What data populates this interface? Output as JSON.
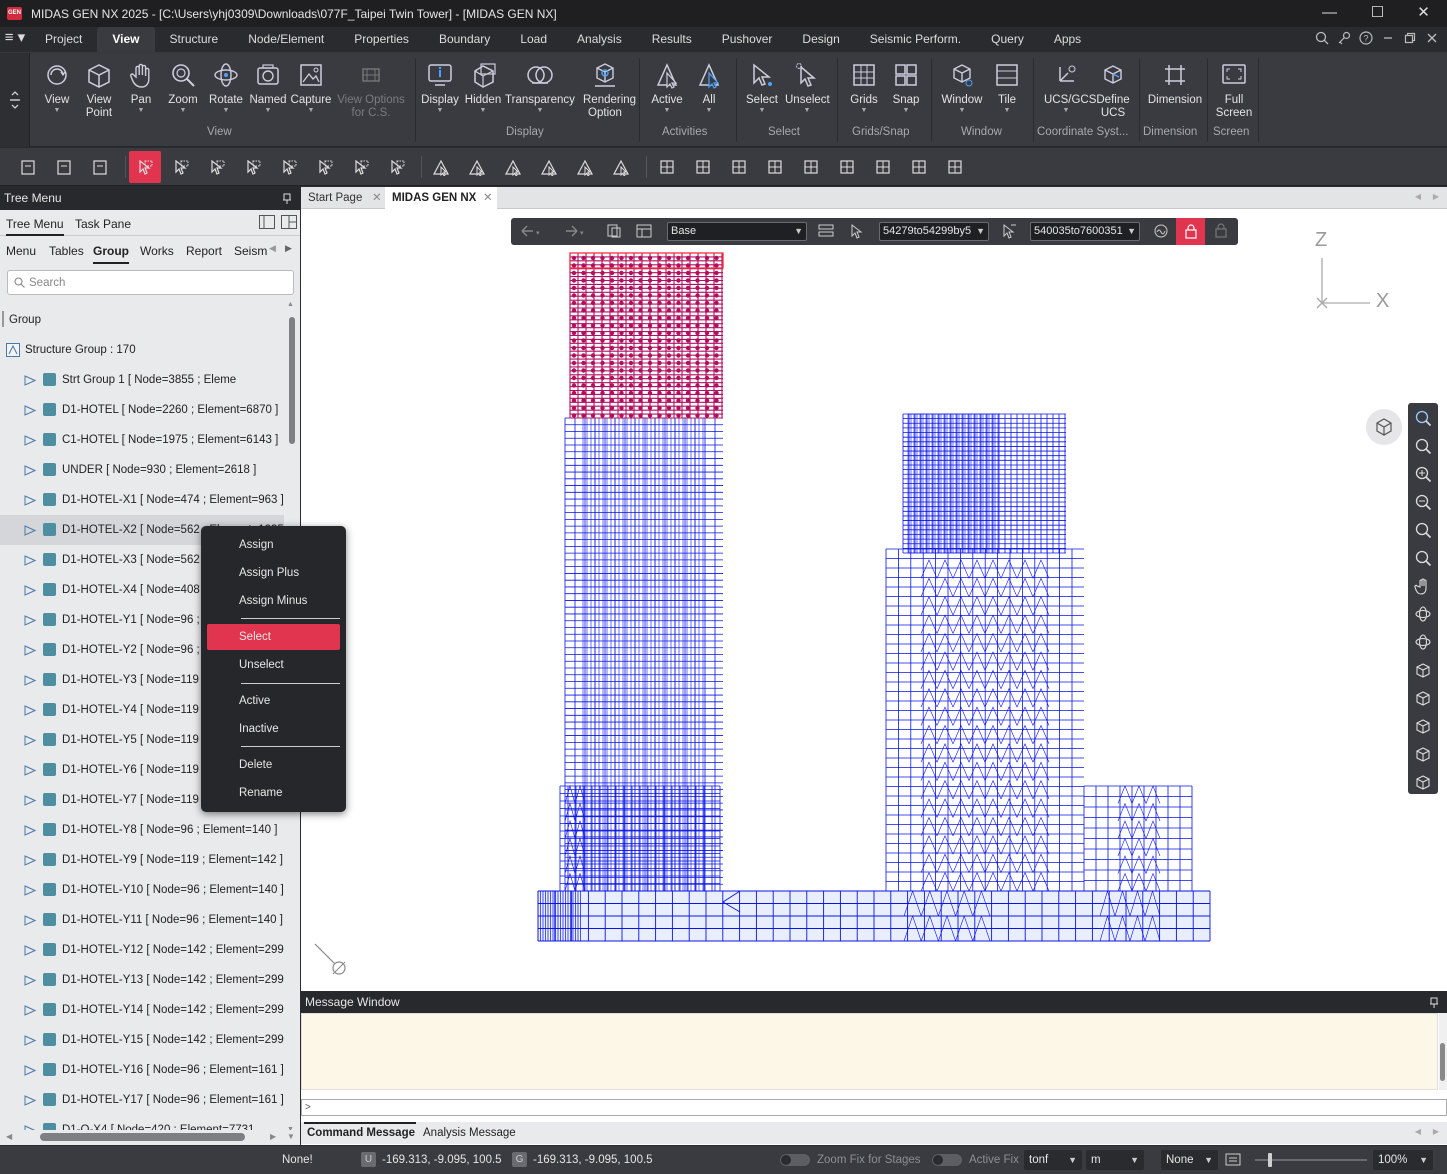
{
  "app": {
    "logo_text": "GEN",
    "title": "MIDAS GEN NX 2025 - [C:\\Users\\yhj0309\\Downloads\\077F_Taipei Twin Tower] - [MIDAS GEN NX]",
    "window_buttons": {
      "minimize": "—",
      "maximize": "☐",
      "close": "✕"
    }
  },
  "menu": {
    "hamburger": "≡ ▾",
    "tabs": [
      "Project",
      "View",
      "Structure",
      "Node/Element",
      "Properties",
      "Boundary",
      "Load",
      "Analysis",
      "Results",
      "Pushover",
      "Design",
      "Seismic Perform.",
      "Query",
      "Apps"
    ],
    "active_tab": "View"
  },
  "ribbon": {
    "buttons": [
      {
        "label": "View",
        "label2": "",
        "icon": "view-icon",
        "dropdown": true
      },
      {
        "label": "View",
        "label2": "Point",
        "icon": "view-point-icon",
        "dropdown": true
      },
      {
        "label": "Pan",
        "label2": "",
        "icon": "pan-hand-icon",
        "dropdown": true
      },
      {
        "label": "Zoom",
        "label2": "",
        "icon": "zoom-icon",
        "dropdown": true
      },
      {
        "label": "Rotate",
        "label2": "",
        "icon": "rotate-icon",
        "dropdown": true
      },
      {
        "label": "Named",
        "label2": "",
        "icon": "named-view-icon",
        "dropdown": true
      },
      {
        "label": "Capture",
        "label2": "",
        "icon": "capture-icon",
        "dropdown": true
      },
      {
        "label": "View Options",
        "label2": "for C.S.",
        "icon": "view-options-icon",
        "dropdown": false
      },
      {
        "label": "Display",
        "label2": "",
        "icon": "display-icon",
        "dropdown": true
      },
      {
        "label": "Hidden",
        "label2": "",
        "icon": "hidden-icon",
        "dropdown": true
      },
      {
        "label": "Transparency",
        "label2": "",
        "icon": "transparency-icon",
        "dropdown": true
      },
      {
        "label": "Rendering",
        "label2": "Option",
        "icon": "rendering-icon",
        "dropdown": false
      },
      {
        "label": "Active",
        "label2": "",
        "icon": "active-icon",
        "dropdown": true
      },
      {
        "label": "All",
        "label2": "",
        "icon": "active-all-icon",
        "dropdown": true
      },
      {
        "label": "Select",
        "label2": "",
        "icon": "select-icon",
        "dropdown": true
      },
      {
        "label": "Unselect",
        "label2": "",
        "icon": "unselect-icon",
        "dropdown": true
      },
      {
        "label": "Grids",
        "label2": "",
        "icon": "grids-icon",
        "dropdown": true
      },
      {
        "label": "Snap",
        "label2": "",
        "icon": "snap-icon",
        "dropdown": true
      },
      {
        "label": "Window",
        "label2": "",
        "icon": "window-icon",
        "dropdown": true
      },
      {
        "label": "Tile",
        "label2": "",
        "icon": "tile-icon",
        "dropdown": true
      },
      {
        "label": "UCS/GCS",
        "label2": "",
        "icon": "ucs-gcs-icon",
        "dropdown": true
      },
      {
        "label": "Define",
        "label2": "UCS",
        "icon": "define-ucs-icon",
        "dropdown": false
      },
      {
        "label": "Dimension",
        "label2": "",
        "icon": "dimension-icon",
        "dropdown": false
      },
      {
        "label": "Full",
        "label2": "Screen",
        "icon": "full-screen-icon",
        "dropdown": false
      }
    ],
    "groups": [
      "View",
      "Display",
      "Activities",
      "Select",
      "Grids/Snap",
      "Window",
      "Coordinate Syst...",
      "Dimension",
      "Screen"
    ]
  },
  "toolbar_icons": [
    "new-file-icon",
    "open-file-icon",
    "open-project-icon",
    "select-pointer-icon",
    "select-window-icon",
    "select-polygon-icon",
    "select-intersect-icon",
    "select-plane-icon",
    "select-volume-icon",
    "select-previous-icon",
    "select-by-id-icon",
    "activate-icon",
    "inactivate-icon",
    "active-all-icon",
    "inverse-active-icon",
    "active-previous-icon",
    "active-identity-icon",
    "wall-icon",
    "grid-frame-icon",
    "building-icon",
    "model-view-icon",
    "monitor-icon",
    "node-number-icon",
    "element-number-icon",
    "polygon-select-icon",
    "vehicle-icon"
  ],
  "left_panel": {
    "title": "Tree Menu",
    "tabs": [
      "Tree Menu",
      "Task Pane"
    ],
    "subtabs": [
      "Menu",
      "Tables",
      "Group",
      "Works",
      "Report",
      "Seism"
    ],
    "active_subtab": "Group",
    "search_placeholder": "Search",
    "root": "Group",
    "structure_group": "Structure Group : 170",
    "items": [
      "Strt Group 1 [ Node=3855 ; Eleme",
      "D1-HOTEL [ Node=2260 ; Element=6870 ]",
      "C1-HOTEL [ Node=1975 ; Element=6143 ]",
      "UNDER [ Node=930 ; Element=2618 ]",
      "D1-HOTEL-X1 [ Node=474 ; Element=963 ]",
      "D1-HOTEL-X2 [ Node=562 ; Element=1235 ]",
      "D1-HOTEL-X3 [ Node=562 ;",
      "D1-HOTEL-X4 [ Node=408 ;",
      "D1-HOTEL-Y1 [ Node=96 ; E",
      "D1-HOTEL-Y2 [ Node=96 ; E",
      "D1-HOTEL-Y3 [ Node=119 ;",
      "D1-HOTEL-Y4 [ Node=119 ;",
      "D1-HOTEL-Y5 [ Node=119 ;",
      "D1-HOTEL-Y6 [ Node=119 ;",
      "D1-HOTEL-Y7 [ Node=119 ;",
      "D1-HOTEL-Y8 [ Node=96 ; Element=140 ]",
      "D1-HOTEL-Y9 [ Node=119 ; Element=142 ]",
      "D1-HOTEL-Y10 [ Node=96 ; Element=140 ]",
      "D1-HOTEL-Y11 [ Node=96 ; Element=140 ]",
      "D1-HOTEL-Y12 [ Node=142 ; Element=299 ]",
      "D1-HOTEL-Y13 [ Node=142 ; Element=299 ]",
      "D1-HOTEL-Y14 [ Node=142 ; Element=299 ]",
      "D1-HOTEL-Y15 [ Node=142 ; Element=299 ]",
      "D1-HOTEL-Y16 [ Node=96 ; Element=161 ]",
      "D1-HOTEL-Y17 [ Node=96 ; Element=161 ]",
      "D1-O-X4 [ Node=420 ; Element=7731"
    ],
    "selected_item": "D1-HOTEL-X2 [ Node=562 ; Element=1235 ]"
  },
  "context_menu": {
    "items": [
      "Assign",
      "Assign Plus",
      "Assign Minus",
      "Select",
      "Unselect",
      "Active",
      "Inactive",
      "Delete",
      "Rename"
    ],
    "highlighted": "Select"
  },
  "doc_tabs": [
    "Start Page",
    "MIDAS GEN NX"
  ],
  "active_doc_tab": "MIDAS GEN NX",
  "viewport_toolbar": {
    "stage": "Base",
    "select_range_1": "54279to54299by5",
    "select_range_2": "540035to7600351"
  },
  "axes": {
    "z": "Z",
    "x": "X"
  },
  "message_window": {
    "title": "Message Window",
    "prompt": ">",
    "tabs": [
      "Command Message",
      "Analysis Message"
    ],
    "active_tab": "Command Message"
  },
  "status_bar": {
    "selection": "None!",
    "ucs_label": "U",
    "ucs_coords": "-169.313, -9.095, 100.5",
    "gcs_label": "G",
    "gcs_coords": "-169.313, -9.095, 100.5",
    "zoom_fix": "Zoom Fix for Stages",
    "active_fix": "Active Fix",
    "force_unit": "tonf",
    "length_unit": "m",
    "filter": "None",
    "zoom_level": "100%"
  },
  "colors": {
    "accent": "#e0344f",
    "mesh_blue": "#0a14e6",
    "mesh_selected": "#b0105f"
  }
}
